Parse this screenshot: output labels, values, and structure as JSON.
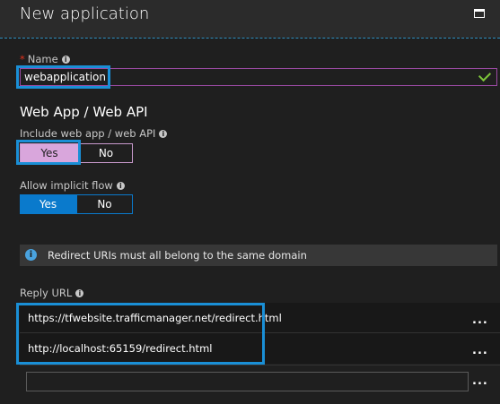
{
  "window": {
    "title": "New application"
  },
  "name_field": {
    "label": "Name",
    "value": "webapplication"
  },
  "web_section": {
    "heading": "Web App / Web API"
  },
  "include_web_app": {
    "label": "Include web app / web API",
    "yes": "Yes",
    "no": "No",
    "selected": "Yes"
  },
  "implicit_flow": {
    "label": "Allow implicit flow",
    "yes": "Yes",
    "no": "No",
    "selected": "Yes"
  },
  "banner": {
    "text": "Redirect URIs must all belong to the same domain"
  },
  "reply_url": {
    "label": "Reply URL",
    "urls": [
      "https://tfwebsite.trafficmanager.net/redirect.html",
      "http://localhost:65159/redirect.html"
    ],
    "more_label": "...",
    "new_value": ""
  },
  "colors": {
    "accent_blue": "#1a8fd6",
    "toggle_selected_pink": "#d9a6dc",
    "toggle_selected_blue": "#0a7acc",
    "valid_check": "#7ec53a",
    "required_star": "#e0321c"
  }
}
